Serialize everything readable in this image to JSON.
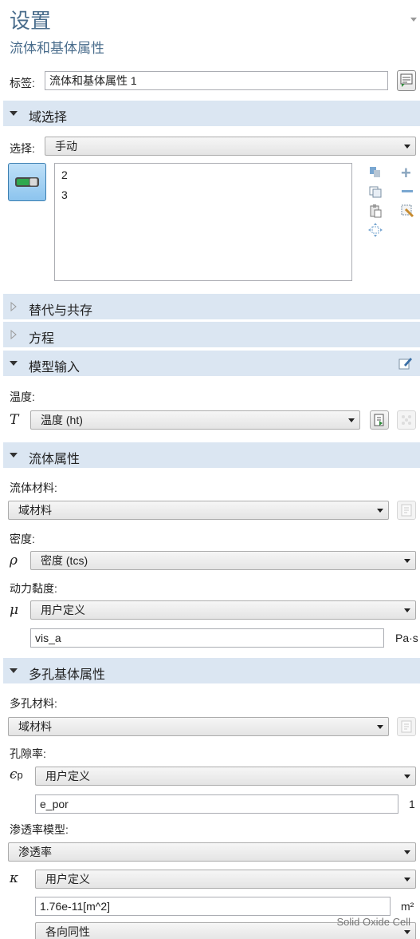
{
  "header": {
    "title": "设置",
    "subtitle": "流体和基体属性"
  },
  "label_row": {
    "label": "标签:",
    "value": "流体和基体属性 1"
  },
  "sections": {
    "domain_selection": "域选择",
    "override": "替代与共存",
    "equation": "方程",
    "model_input": "模型输入",
    "fluid_properties": "流体属性",
    "porous_matrix": "多孔基体属性"
  },
  "domain_selection": {
    "select_label": "选择:",
    "select_value": "手动",
    "domains": [
      "2",
      "3"
    ]
  },
  "model_input": {
    "temperature_label": "温度:",
    "temperature_symbol": "T",
    "temperature_value": "温度 (ht)"
  },
  "fluid": {
    "material_label": "流体材料:",
    "material_value": "域材料",
    "density_label": "密度:",
    "density_symbol": "ρ",
    "density_value": "密度 (tcs)",
    "viscosity_label": "动力黏度:",
    "viscosity_symbol": "μ",
    "viscosity_value": "用户定义",
    "viscosity_expr": "vis_a",
    "viscosity_unit": "Pa·s"
  },
  "porous": {
    "material_label": "多孔材料:",
    "material_value": "域材料",
    "porosity_label": "孔隙率:",
    "porosity_symbol": "ϵ",
    "porosity_subscript": "p",
    "porosity_value": "用户定义",
    "porosity_expr": "e_por",
    "porosity_unit": "1",
    "perm_model_label": "渗透率模型:",
    "perm_model_value": "渗透率",
    "perm_symbol": "κ",
    "perm_value": "用户定义",
    "perm_expr": "1.76e-11[m^2]",
    "perm_unit": "m²",
    "isotropy_value": "各向同性"
  },
  "watermark": "Solid Oxide Cell",
  "colors": {
    "accent_text": "#4a6d8c",
    "section_bg": "#dbe6f2"
  }
}
